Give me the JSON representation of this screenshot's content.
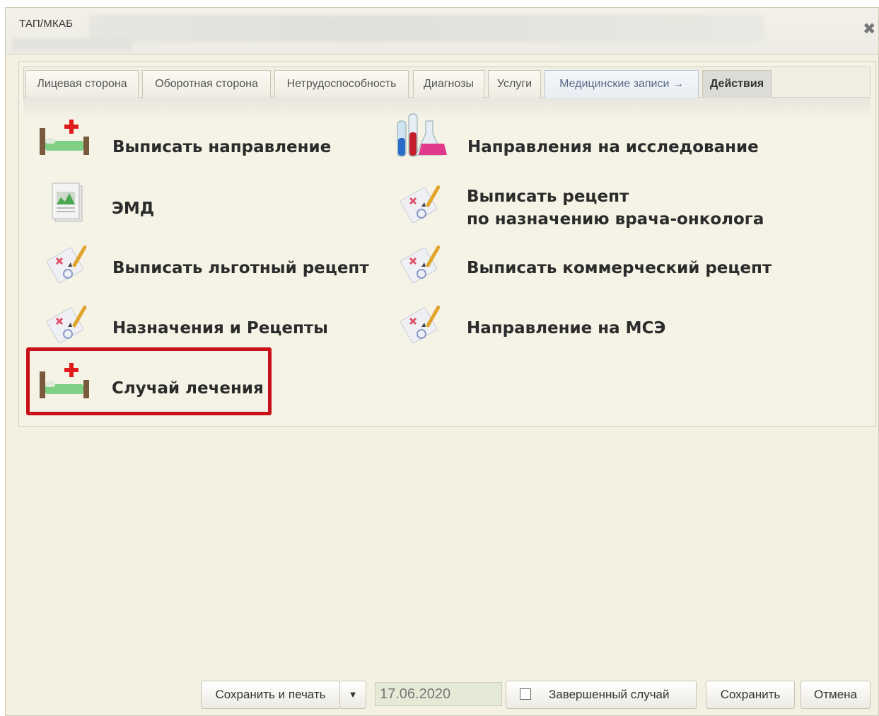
{
  "window": {
    "title": "ТАП/МКАБ",
    "close_glyph": "✖"
  },
  "tabs": [
    {
      "label": "Лицевая сторона"
    },
    {
      "label": "Оборотная сторона"
    },
    {
      "label": "Нетрудоспособность"
    },
    {
      "label": "Диагнозы"
    },
    {
      "label": "Услуги"
    },
    {
      "label": "Медицинские записи →"
    },
    {
      "label": "Действия",
      "active": true
    }
  ],
  "actions": {
    "referral": {
      "label": "Выписать направление",
      "icon": "hospital-bed-icon"
    },
    "research": {
      "label": "Направления на исследование",
      "icon": "lab-flasks-icon"
    },
    "emd": {
      "label": "ЭМД",
      "icon": "document-icon"
    },
    "oncology_line1": "Выписать рецепт",
    "oncology_line2": "по назначению врача-онколога",
    "preferential": {
      "label": "Выписать льготный рецепт",
      "icon": "prescription-icon"
    },
    "commercial": {
      "label": "Выписать коммерческий рецепт",
      "icon": "prescription-icon"
    },
    "prescriptions": {
      "label": "Назначения и Рецепты",
      "icon": "prescription-icon"
    },
    "mse": {
      "label": "Направление на МСЭ",
      "icon": "prescription-icon"
    },
    "treatment_case": {
      "label": "Случай лечения",
      "icon": "hospital-bed-icon"
    }
  },
  "footer": {
    "save_print": "Сохранить и печать",
    "dropdown_glyph": "▼",
    "date_value": "17.06.2020",
    "completed_case": "Завершенный случай",
    "completed_checked": false,
    "save": "Сохранить",
    "cancel": "Отмена"
  },
  "colors": {
    "highlight": "#c8101a",
    "background": "#f4f1e2"
  }
}
